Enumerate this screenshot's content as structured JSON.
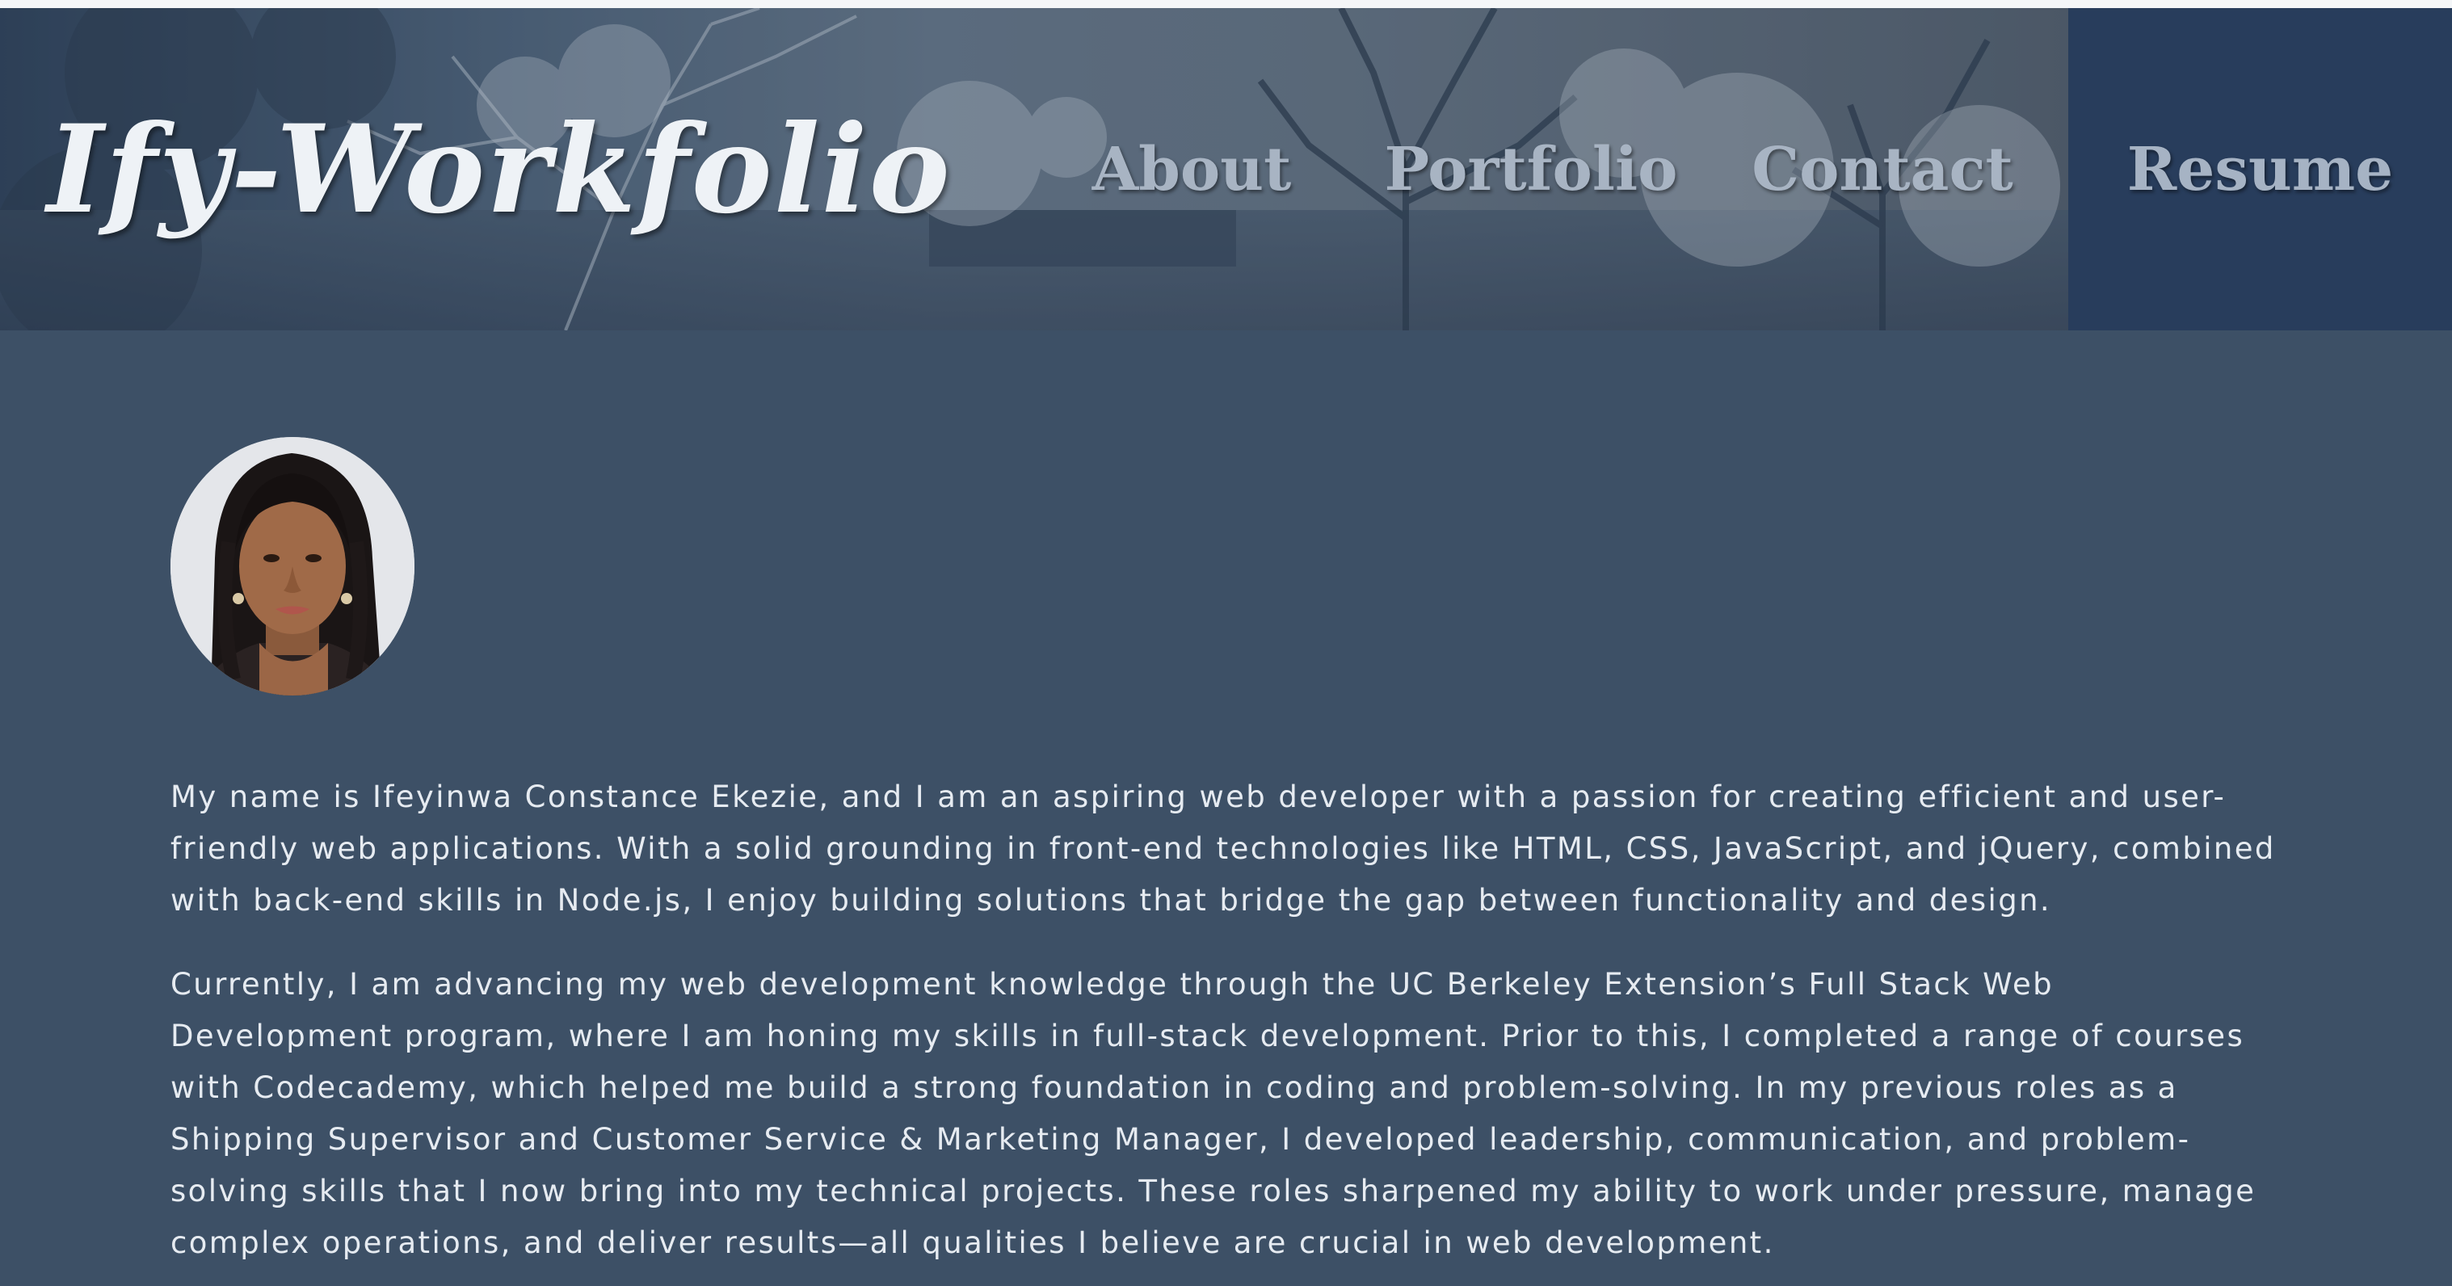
{
  "header": {
    "brand": "Ify-Workfolio",
    "nav": [
      {
        "label": "About"
      },
      {
        "label": "Portfolio"
      },
      {
        "label": "Contact"
      },
      {
        "label": "Resume",
        "active": true
      }
    ]
  },
  "colors": {
    "page_background": "#3d5066",
    "active_nav_background": "#283d5c",
    "text": "#e6ebf1",
    "nav_text": "#a8b4c3"
  },
  "about": {
    "paragraphs": [
      "My name is Ifeyinwa Constance Ekezie, and I am an aspiring web developer with a passion for creating efficient and user-friendly web applications. With a solid grounding in front-end technologies like HTML, CSS, JavaScript, and jQuery, combined with back-end skills in Node.js, I enjoy building solutions that bridge the gap between functionality and design.",
      "Currently, I am advancing my web development knowledge through the UC Berkeley Extension’s Full Stack Web Development program, where I am honing my skills in full-stack development. Prior to this, I completed a range of courses with Codecademy, which helped me build a strong foundation in coding and problem-solving. In my previous roles as a Shipping Supervisor and Customer Service & Marketing Manager, I developed leadership, communication, and problem-solving skills that I now bring into my technical projects. These roles sharpened my ability to work under pressure, manage complex operations, and deliver results—all qualities I believe are crucial in web development."
    ]
  }
}
